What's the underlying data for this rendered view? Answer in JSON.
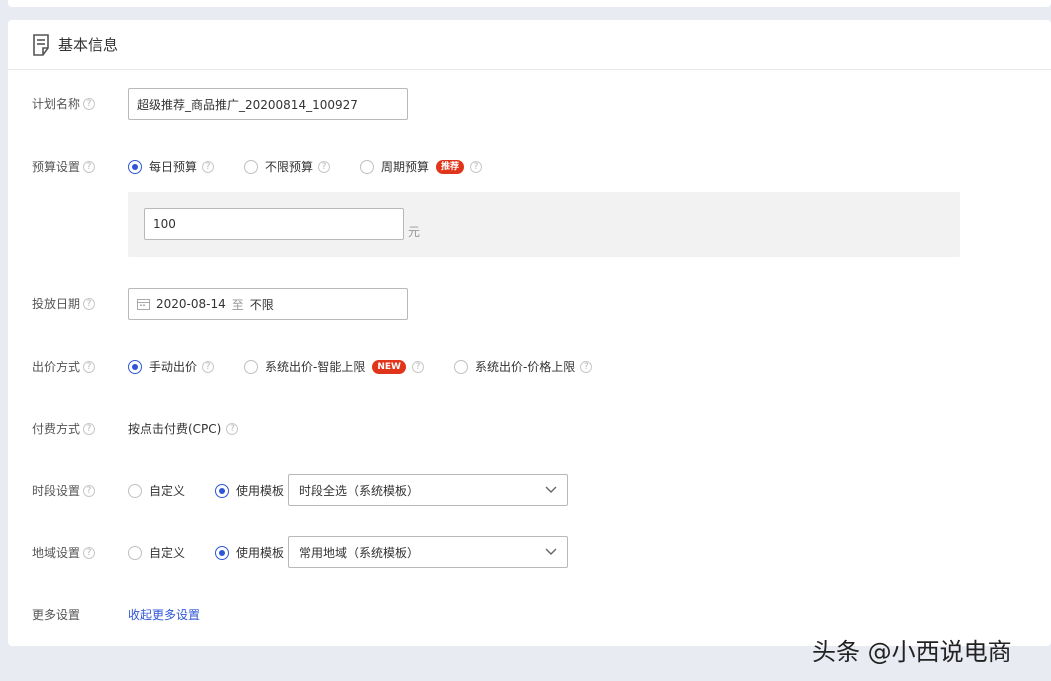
{
  "section": {
    "title": "基本信息"
  },
  "fields": {
    "plan_name": {
      "label": "计划名称",
      "value": "超级推荐_商品推广_20200814_100927"
    },
    "budget": {
      "label": "预算设置",
      "options": [
        "每日预算",
        "不限预算",
        "周期预算"
      ],
      "selected": "每日预算",
      "badge": "推荐",
      "amount": "100",
      "unit": "元"
    },
    "date": {
      "label": "投放日期",
      "start": "2020-08-14",
      "sep": "至",
      "end": "不限"
    },
    "bid": {
      "label": "出价方式",
      "options": [
        "手动出价",
        "系统出价-智能上限",
        "系统出价-价格上限"
      ],
      "selected": "手动出价",
      "badge": "NEW"
    },
    "pay": {
      "label": "付费方式",
      "value": "按点击付费(CPC)"
    },
    "time": {
      "label": "时段设置",
      "options": [
        "自定义",
        "使用模板"
      ],
      "selected": "使用模板",
      "template": "时段全选（系统模板）"
    },
    "region": {
      "label": "地域设置",
      "options": [
        "自定义",
        "使用模板"
      ],
      "selected": "使用模板",
      "template": "常用地域（系统模板）"
    },
    "more": {
      "label": "更多设置",
      "link": "收起更多设置"
    }
  },
  "watermark": "头条 @小西说电商",
  "colors": {
    "accent": "#2f56d6",
    "badge": "#e0341b",
    "background": "#e9ebf2"
  },
  "icons": {
    "help": "?"
  }
}
